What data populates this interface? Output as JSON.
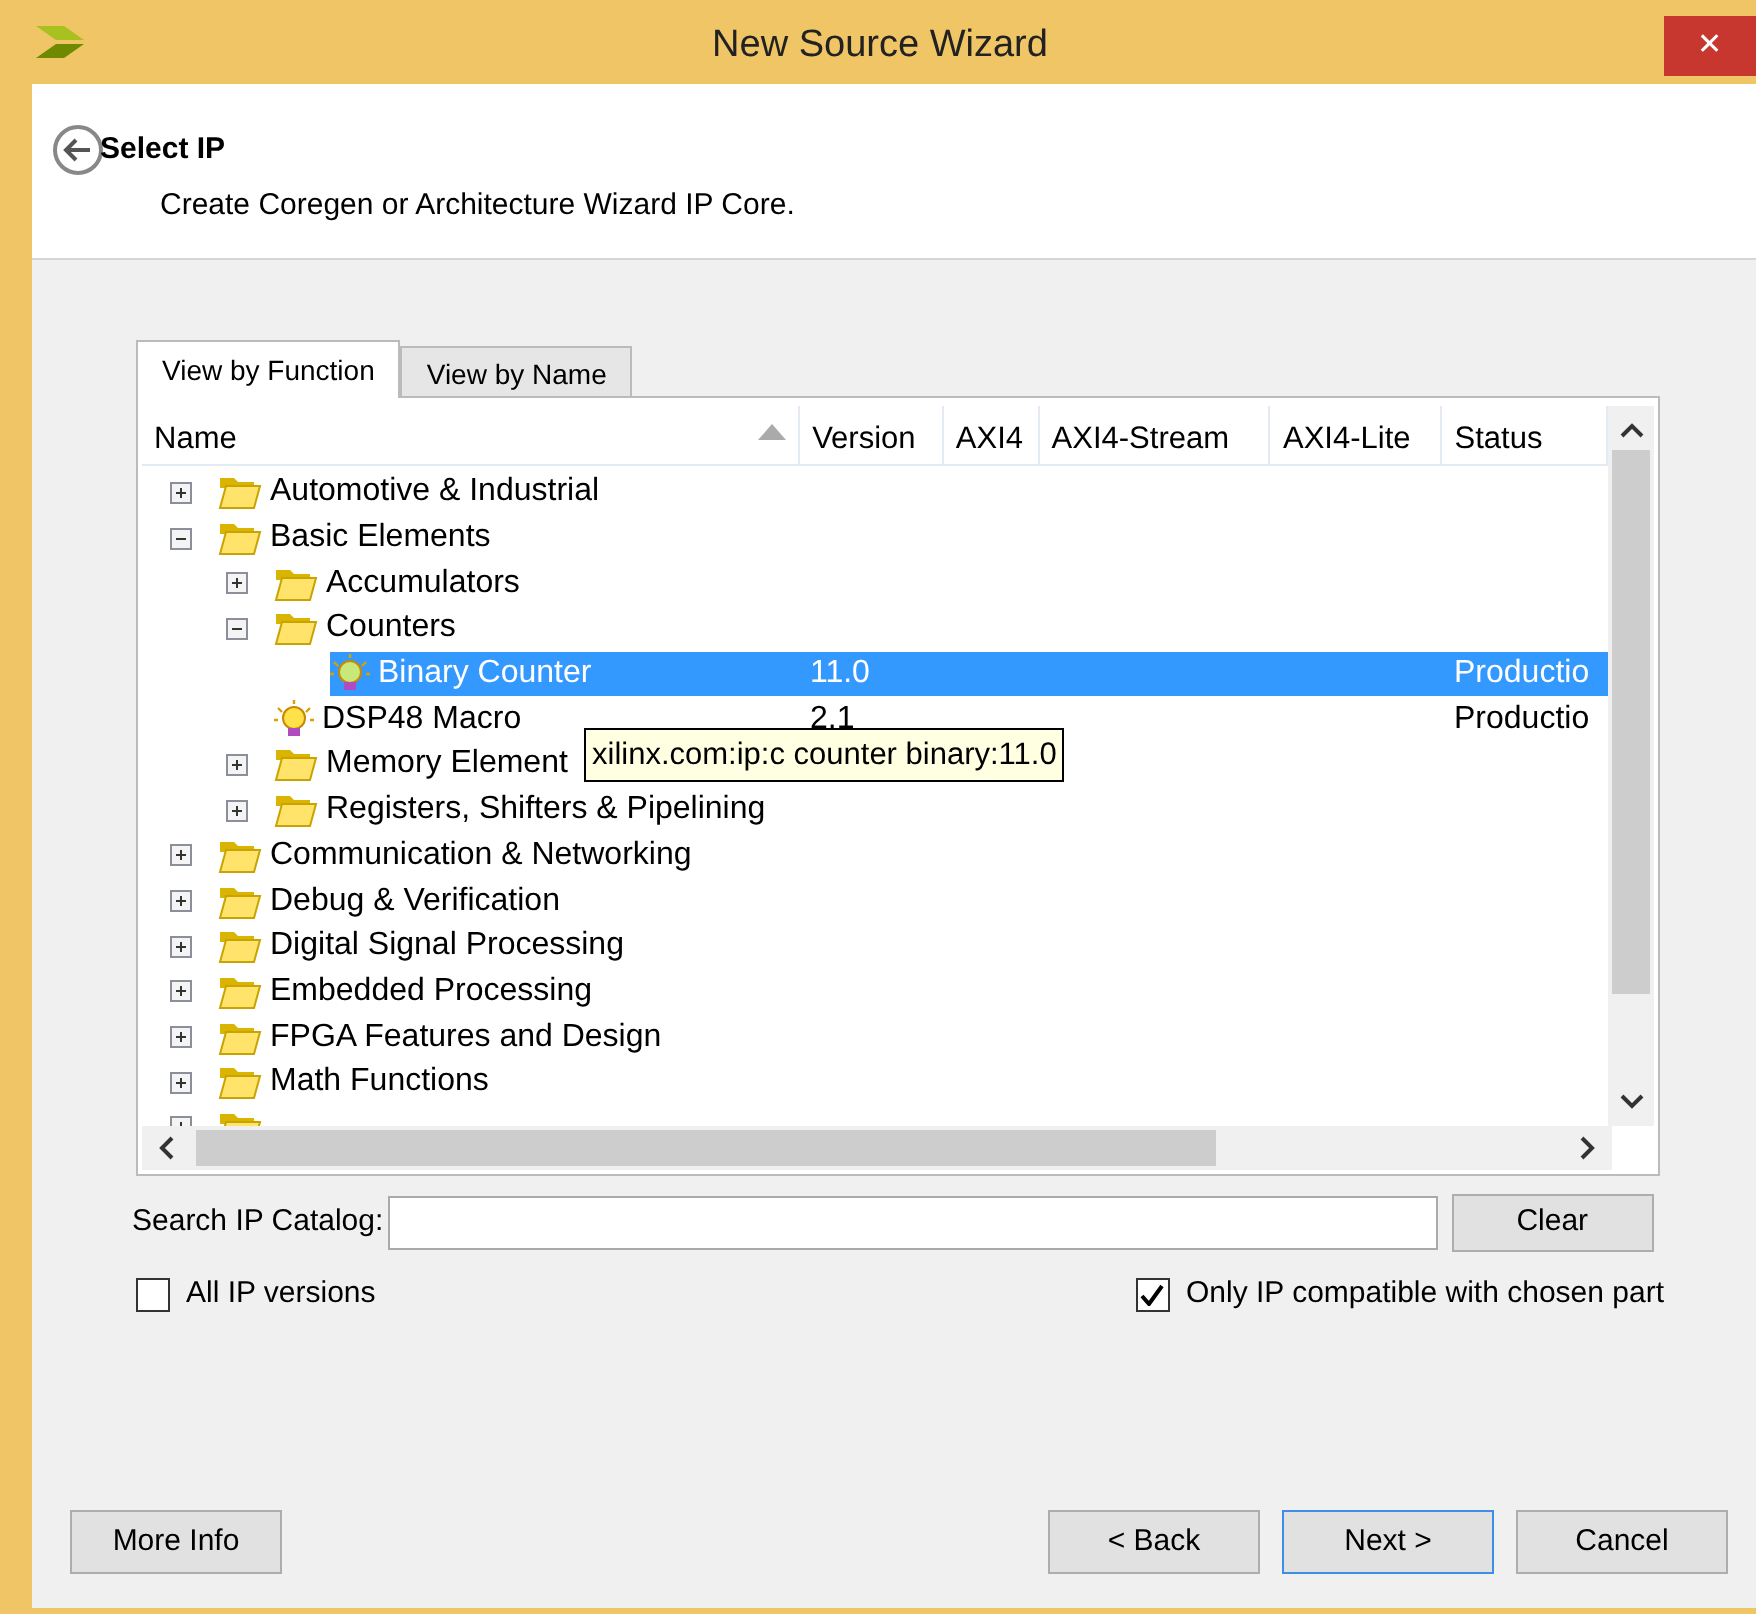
{
  "window": {
    "title": "New Source Wizard",
    "close": "✕"
  },
  "header": {
    "title": "Select IP",
    "subtitle": "Create Coregen or Architecture Wizard IP Core."
  },
  "tabs": [
    {
      "label": "View by Function",
      "selected": true
    },
    {
      "label": "View by Name",
      "selected": false
    }
  ],
  "table": {
    "columns": [
      {
        "label": "Name",
        "sorted": true
      },
      {
        "label": "Version"
      },
      {
        "label": "AXI4"
      },
      {
        "label": "AXI4-Stream"
      },
      {
        "label": "AXI4-Lite"
      },
      {
        "label": "Status"
      }
    ],
    "rows": [
      {
        "kind": "folder",
        "name": "Automotive & Industrial",
        "expanded": false,
        "selected": false
      },
      {
        "kind": "folder",
        "name": "Basic Elements",
        "expanded": true,
        "selected": false,
        "children": [
          {
            "kind": "folder",
            "name": "Accumulators",
            "expanded": false,
            "selected": false
          },
          {
            "kind": "folder",
            "name": "Counters",
            "expanded": true,
            "selected": false,
            "children": [
              {
                "kind": "ip",
                "name": "Binary Counter",
                "version": "11.0",
                "status": "Productio",
                "selected": true
              }
            ]
          },
          {
            "kind": "ip",
            "name": "DSP48 Macro",
            "version": "2.1",
            "status": "Productio",
            "selected": false
          },
          {
            "kind": "folder",
            "name": "Memory Element",
            "expanded": false,
            "selected": false
          },
          {
            "kind": "folder",
            "name": "Registers, Shifters & Pipelining",
            "expanded": false,
            "selected": false
          }
        ]
      },
      {
        "kind": "folder",
        "name": "Communication & Networking",
        "expanded": false,
        "selected": false
      },
      {
        "kind": "folder",
        "name": "Debug & Verification",
        "expanded": false,
        "selected": false
      },
      {
        "kind": "folder",
        "name": "Digital Signal Processing",
        "expanded": false,
        "selected": false
      },
      {
        "kind": "folder",
        "name": "Embedded Processing",
        "expanded": false,
        "selected": false
      },
      {
        "kind": "folder",
        "name": "FPGA Features and Design",
        "expanded": false,
        "selected": false
      },
      {
        "kind": "folder",
        "name": "Math Functions",
        "expanded": false,
        "selected": false
      },
      {
        "kind": "folder",
        "expanded": false,
        "selected": false
      }
    ]
  },
  "tooltip": "xilinx.com:ip:c counter binary:11.0",
  "search": {
    "label": "Search IP Catalog:",
    "button": "Clear"
  },
  "options": [
    {
      "label": "All IP versions",
      "checked": false
    },
    {
      "label": "Only IP compatible with chosen part",
      "checked": true
    }
  ],
  "buttons": [
    {
      "label": "More Info",
      "default": false
    },
    {
      "label": "< Back",
      "default": false
    },
    {
      "label": "Next >",
      "default": true
    },
    {
      "label": "Cancel",
      "default": false
    }
  ]
}
